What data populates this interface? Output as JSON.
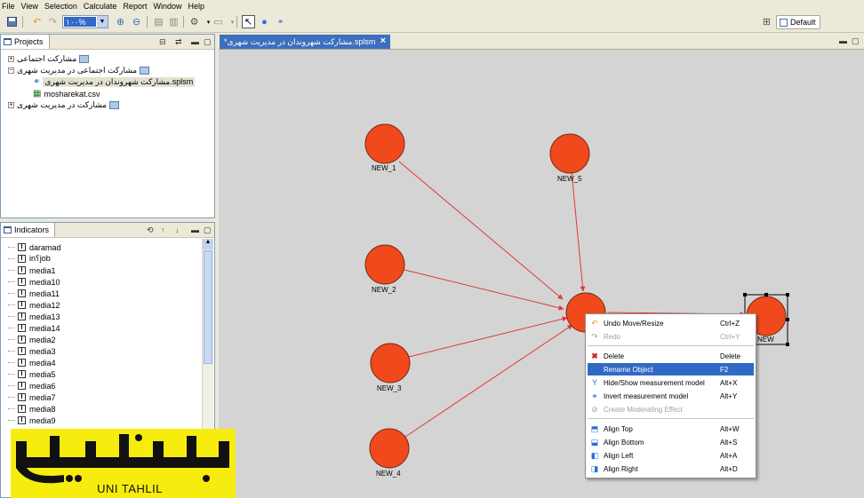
{
  "menubar": [
    "File",
    "View",
    "Selection",
    "Calculate",
    "Report",
    "Window",
    "Help"
  ],
  "toolbar": {
    "zoom_value": "۱۰۰%",
    "perspective": "Default"
  },
  "projects": {
    "title": "Projects",
    "items": [
      {
        "label": "مشارکت اجتماعی",
        "level": 0,
        "expandable": true
      },
      {
        "label": "مشارکت اجتماعی در مدیریت شهری",
        "level": 0,
        "expandable": true
      },
      {
        "label": "مشارکت شهروندان در مدیریت شهری.splsm",
        "level": 1,
        "expandable": false,
        "selected": true
      },
      {
        "label": "mosharekat.csv",
        "level": 1,
        "expandable": false
      },
      {
        "label": "مشارکت در مدیریت شهری",
        "level": 0,
        "expandable": true
      }
    ]
  },
  "indicators": {
    "title": "Indicators",
    "items": [
      "daramad",
      "i‌n؟job",
      "media1",
      "media10",
      "media11",
      "media12",
      "media13",
      "media14",
      "media2",
      "media3",
      "media4",
      "media5",
      "media6",
      "media7",
      "media8",
      "media9"
    ]
  },
  "editor": {
    "tab_label": "*مشارکت شهروندان در مدیریت شهری.splsm",
    "nodes": [
      "NEW_1",
      "NEW_5",
      "NEW_2",
      "NEW_3",
      "NEW_4",
      "NEW"
    ]
  },
  "context_menu": {
    "items": [
      {
        "label": "Undo Move/Resize",
        "shortcut": "Ctrl+Z",
        "icon": "undo-icon",
        "disabled": false
      },
      {
        "label": "Redo",
        "shortcut": "Ctrl+Y",
        "icon": "redo-icon",
        "disabled": true
      },
      {
        "label": "Delete",
        "shortcut": "Delete",
        "icon": "delete-icon",
        "disabled": false
      },
      {
        "label": "Rename Object",
        "shortcut": "F2",
        "icon": "",
        "disabled": false,
        "highlighted": true
      },
      {
        "label": "Hide/Show measurement model",
        "shortcut": "Alt+X",
        "icon": "measurement-icon",
        "disabled": false
      },
      {
        "label": "Invert measurement model",
        "shortcut": "Alt+Y",
        "icon": "invert-icon",
        "disabled": false
      },
      {
        "label": "Create Moderating Effect",
        "shortcut": "",
        "icon": "moderating-icon",
        "disabled": true
      },
      {
        "label": "Align Top",
        "shortcut": "Alt+W",
        "icon": "align-top-icon",
        "disabled": false
      },
      {
        "label": "Align Bottom",
        "shortcut": "Alt+S",
        "icon": "align-bottom-icon",
        "disabled": false
      },
      {
        "label": "Align Left",
        "shortcut": "Alt+A",
        "icon": "align-left-icon",
        "disabled": false
      },
      {
        "label": "Align Right",
        "shortcut": "Alt+D",
        "icon": "align-right-icon",
        "disabled": false
      }
    ]
  },
  "watermark": {
    "brand_persian": "یونی تحلیل",
    "brand_latin": "UNI TAHLIL"
  },
  "colors": {
    "node_fill": "#f04a1c",
    "arrow": "#e03a3a",
    "highlight": "#316ac5",
    "logo_bg": "#f6ed0e"
  }
}
